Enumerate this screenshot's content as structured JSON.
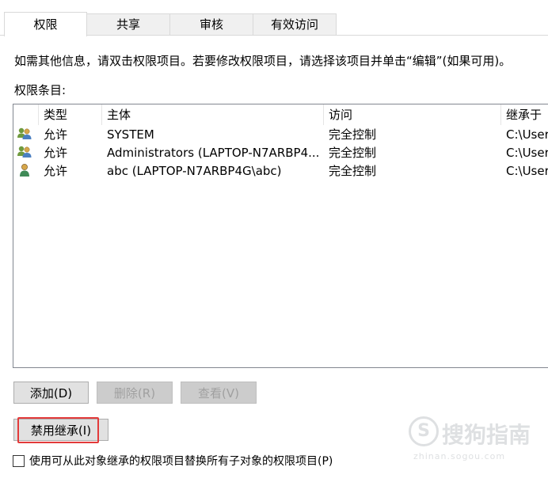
{
  "tabs": [
    {
      "label": "权限",
      "active": true
    },
    {
      "label": "共享",
      "active": false
    },
    {
      "label": "审核",
      "active": false
    },
    {
      "label": "有效访问",
      "active": false
    }
  ],
  "info_text": "如需其他信息，请双击权限项目。若要修改权限项目，请选择该项目并单击“编辑”(如果可用)。",
  "entries_label": "权限条目:",
  "columns": {
    "type": "类型",
    "principal": "主体",
    "access": "访问",
    "inherited_from": "继承于"
  },
  "rows": [
    {
      "icon": "group-user-icon",
      "type": "允许",
      "principal": "SYSTEM",
      "access": "完全控制",
      "inherited_from": "C:\\Users"
    },
    {
      "icon": "group-user-icon",
      "type": "允许",
      "principal": "Administrators (LAPTOP-N7ARBP4...",
      "access": "完全控制",
      "inherited_from": "C:\\Users"
    },
    {
      "icon": "single-user-icon",
      "type": "允许",
      "principal": "abc (LAPTOP-N7ARBP4G\\abc)",
      "access": "完全控制",
      "inherited_from": "C:\\Users"
    }
  ],
  "buttons": {
    "add": "添加(D)",
    "remove": "删除(R)",
    "view": "查看(V)",
    "disable_inheritance": "禁用继承(I)"
  },
  "checkbox": {
    "label": "使用可从此对象继承的权限项目替换所有子对象的权限项目(P)",
    "checked": false
  },
  "watermark": {
    "logo_glyph": "S",
    "text": "搜狗指南",
    "url": "zhinan.sogou.com"
  },
  "colors": {
    "highlight": "#e33a3a",
    "button_bg": "#e1e1e1",
    "disabled_text": "#a0a0a0"
  }
}
